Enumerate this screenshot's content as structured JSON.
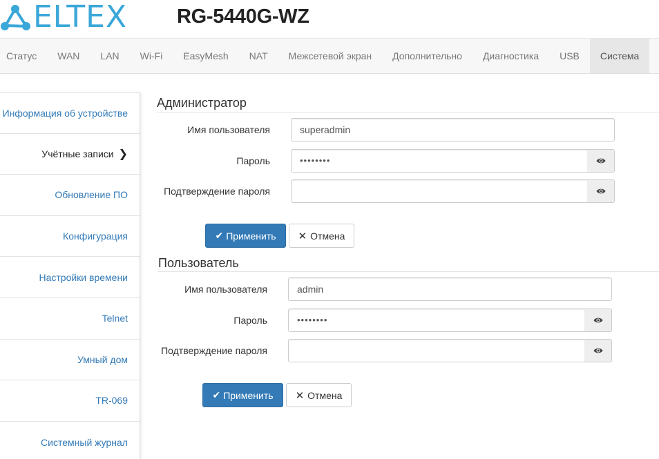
{
  "header": {
    "logo_text": "ELTEX",
    "model": "RG-5440G-WZ"
  },
  "topnav": {
    "items": [
      "Статус",
      "WAN",
      "LAN",
      "Wi-Fi",
      "EasyMesh",
      "NAT",
      "Межсетевой экран",
      "Дополнительно",
      "Диагностика",
      "USB",
      "Система"
    ],
    "active_index": 10
  },
  "sidebar": {
    "items": [
      "Информация об устройстве",
      "Учётные записи",
      "Обновление ПО",
      "Конфигурация",
      "Настройки времени",
      "Telnet",
      "Умный дом",
      "TR-069",
      "Системный журнал"
    ],
    "active_index": 1
  },
  "admin": {
    "title": "Администратор",
    "username_label": "Имя пользователя",
    "username_value": "superadmin",
    "password_label": "Пароль",
    "password_value": "••••••••",
    "confirm_label": "Подтверждение пароля",
    "confirm_value": "",
    "apply_label": "Применить",
    "cancel_label": "Отмена"
  },
  "user": {
    "title": "Пользователь",
    "username_label": "Имя пользователя",
    "username_value": "admin",
    "password_label": "Пароль",
    "password_value": "••••••••",
    "confirm_label": "Подтверждение пароля",
    "confirm_value": "",
    "apply_label": "Применить",
    "cancel_label": "Отмена"
  },
  "icons": {
    "eye": "eye-icon",
    "check": "check-icon",
    "close": "close-icon",
    "chevron": "chevron-right-icon"
  },
  "colors": {
    "brand": "#3aa7d9",
    "primary": "#337ab7",
    "link": "#337ab7"
  }
}
